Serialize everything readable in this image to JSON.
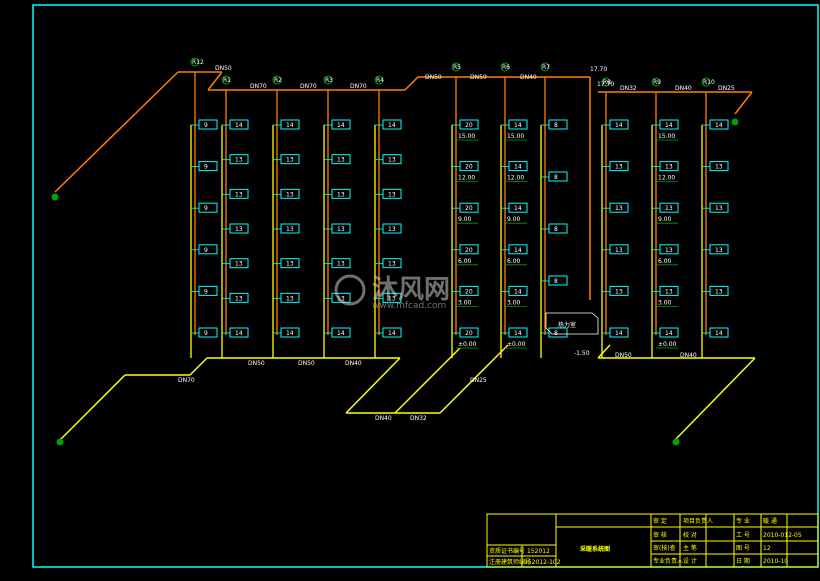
{
  "colors": {
    "background": "#000000",
    "frame": "#00ffff",
    "supply": "#ff8000",
    "return": "#ffff00",
    "radiator": "#00ffff",
    "marker": "#00a000",
    "text": "#ffffff"
  },
  "drawing": {
    "title": "采暖系统图",
    "heat_room_label": "热力室",
    "elevations": [
      "15.00",
      "12.00",
      "9.00",
      "6.00",
      "3.00",
      "±0.00"
    ],
    "top_elevations": [
      "17.70",
      "17.70"
    ],
    "bottom_elevation": "-1.50",
    "supply_pipe_labels": [
      "DN50",
      "DN70",
      "DN70",
      "DN70",
      "DN50",
      "DN50",
      "DN40",
      "DN32",
      "DN40",
      "DN25"
    ],
    "return_pipe_labels": [
      "DN70",
      "DN50",
      "DN50",
      "DN40",
      "DN40",
      "DN32",
      "DN25",
      "DN50",
      "DN40"
    ],
    "risers": [
      {
        "id": "R12",
        "radiators": [
          "9",
          "9",
          "9",
          "9",
          "9",
          "9"
        ]
      },
      {
        "id": "R1",
        "radiators": [
          "14",
          "13",
          "13",
          "13",
          "13",
          "13",
          "14"
        ]
      },
      {
        "id": "R2",
        "radiators": [
          "14",
          "13",
          "13",
          "13",
          "13",
          "13",
          "14"
        ]
      },
      {
        "id": "R3",
        "radiators": [
          "14",
          "13",
          "13",
          "13",
          "13",
          "13",
          "14"
        ]
      },
      {
        "id": "R4",
        "radiators": [
          "14",
          "13",
          "13",
          "13",
          "13",
          "13",
          "14"
        ]
      },
      {
        "id": "R5",
        "radiators": [
          "20",
          "20",
          "20",
          "20",
          "20",
          "20"
        ]
      },
      {
        "id": "R6",
        "radiators": [
          "14",
          "14",
          "14",
          "14",
          "14",
          "14"
        ]
      },
      {
        "id": "R7",
        "radiators": [
          "8",
          "8",
          "8",
          "8",
          "8"
        ]
      },
      {
        "id": "R8",
        "radiators": [
          "14",
          "13",
          "13",
          "13",
          "13",
          "14"
        ]
      },
      {
        "id": "R9",
        "radiators": [
          "14",
          "13",
          "13",
          "13",
          "13",
          "14"
        ]
      },
      {
        "id": "R10",
        "radiators": [
          "14",
          "13",
          "13",
          "13",
          "13",
          "14"
        ]
      }
    ]
  },
  "title_block": {
    "cert_label": "资质证书编号",
    "cert_value": "152012",
    "reg_label": "注册建筑师编号",
    "reg_value": "152012-102",
    "drawing_name": "采暖系统图",
    "rows": [
      {
        "a": "审 定",
        "b": "项目负责人",
        "c": "专 业",
        "d": "暖 通"
      },
      {
        "a": "审 核",
        "b": "校 对",
        "c": "工 号",
        "d": "2010-012-05"
      },
      {
        "a": "审(核)查",
        "b": "主 笔",
        "c": "图 号",
        "d": "12"
      },
      {
        "a": "专业负责人",
        "b": "设 计",
        "c": "日 期",
        "d": "2010-10"
      }
    ]
  },
  "watermark": {
    "text": "沐风网",
    "url_text": "www.mfcad.com"
  }
}
